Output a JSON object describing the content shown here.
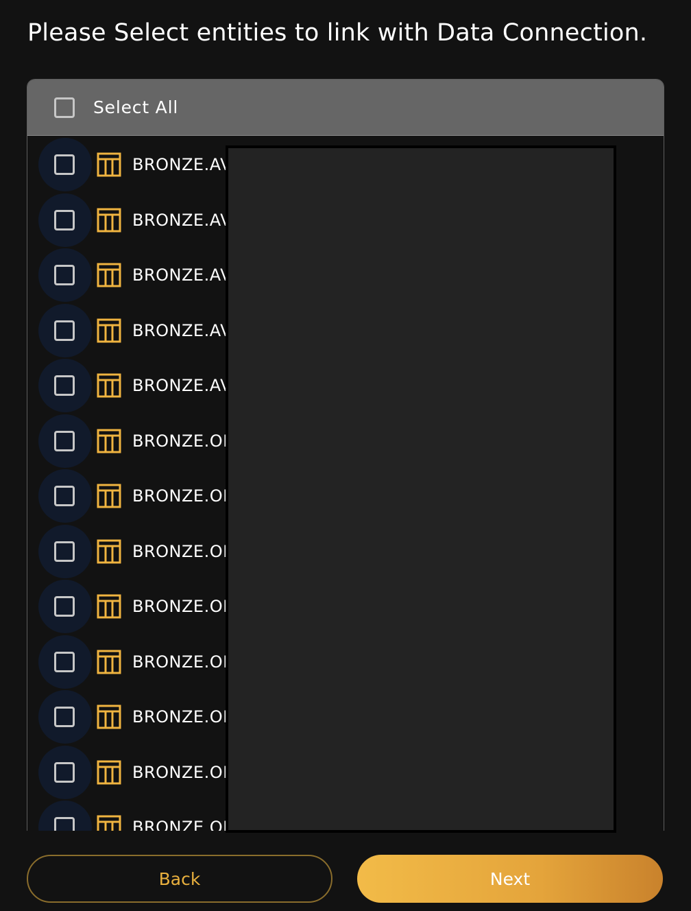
{
  "title": "Please Select entities to link with Data Connection.",
  "select_all": {
    "label": "Select All",
    "checked": false
  },
  "entities": [
    {
      "label": "BRONZE.AV",
      "checked": false,
      "icon": "table-icon"
    },
    {
      "label": "BRONZE.AV",
      "checked": false,
      "icon": "table-icon"
    },
    {
      "label": "BRONZE.AV",
      "checked": false,
      "icon": "table-icon"
    },
    {
      "label": "BRONZE.AV",
      "checked": false,
      "icon": "table-icon"
    },
    {
      "label": "BRONZE.AV",
      "checked": false,
      "icon": "table-icon"
    },
    {
      "label": "BRONZE.OI",
      "checked": false,
      "icon": "table-icon"
    },
    {
      "label": "BRONZE.OI",
      "checked": false,
      "icon": "table-icon"
    },
    {
      "label": "BRONZE.OI",
      "checked": false,
      "icon": "table-icon"
    },
    {
      "label": "BRONZE.OI",
      "checked": false,
      "icon": "table-icon"
    },
    {
      "label": "BRONZE.OI",
      "checked": false,
      "icon": "table-icon"
    },
    {
      "label": "BRONZE.OI",
      "checked": false,
      "icon": "table-icon"
    },
    {
      "label": "BRONZE.OI",
      "checked": false,
      "icon": "table-icon"
    },
    {
      "label": "BRONZE.OI",
      "checked": false,
      "icon": "table-icon"
    }
  ],
  "buttons": {
    "back": "Back",
    "next": "Next"
  },
  "colors": {
    "background": "#121212",
    "header": "#666666",
    "accent": "#e9b03e",
    "icon": "#f0b440",
    "checkbox_halo": "#111a2b",
    "redaction": "#232323"
  }
}
